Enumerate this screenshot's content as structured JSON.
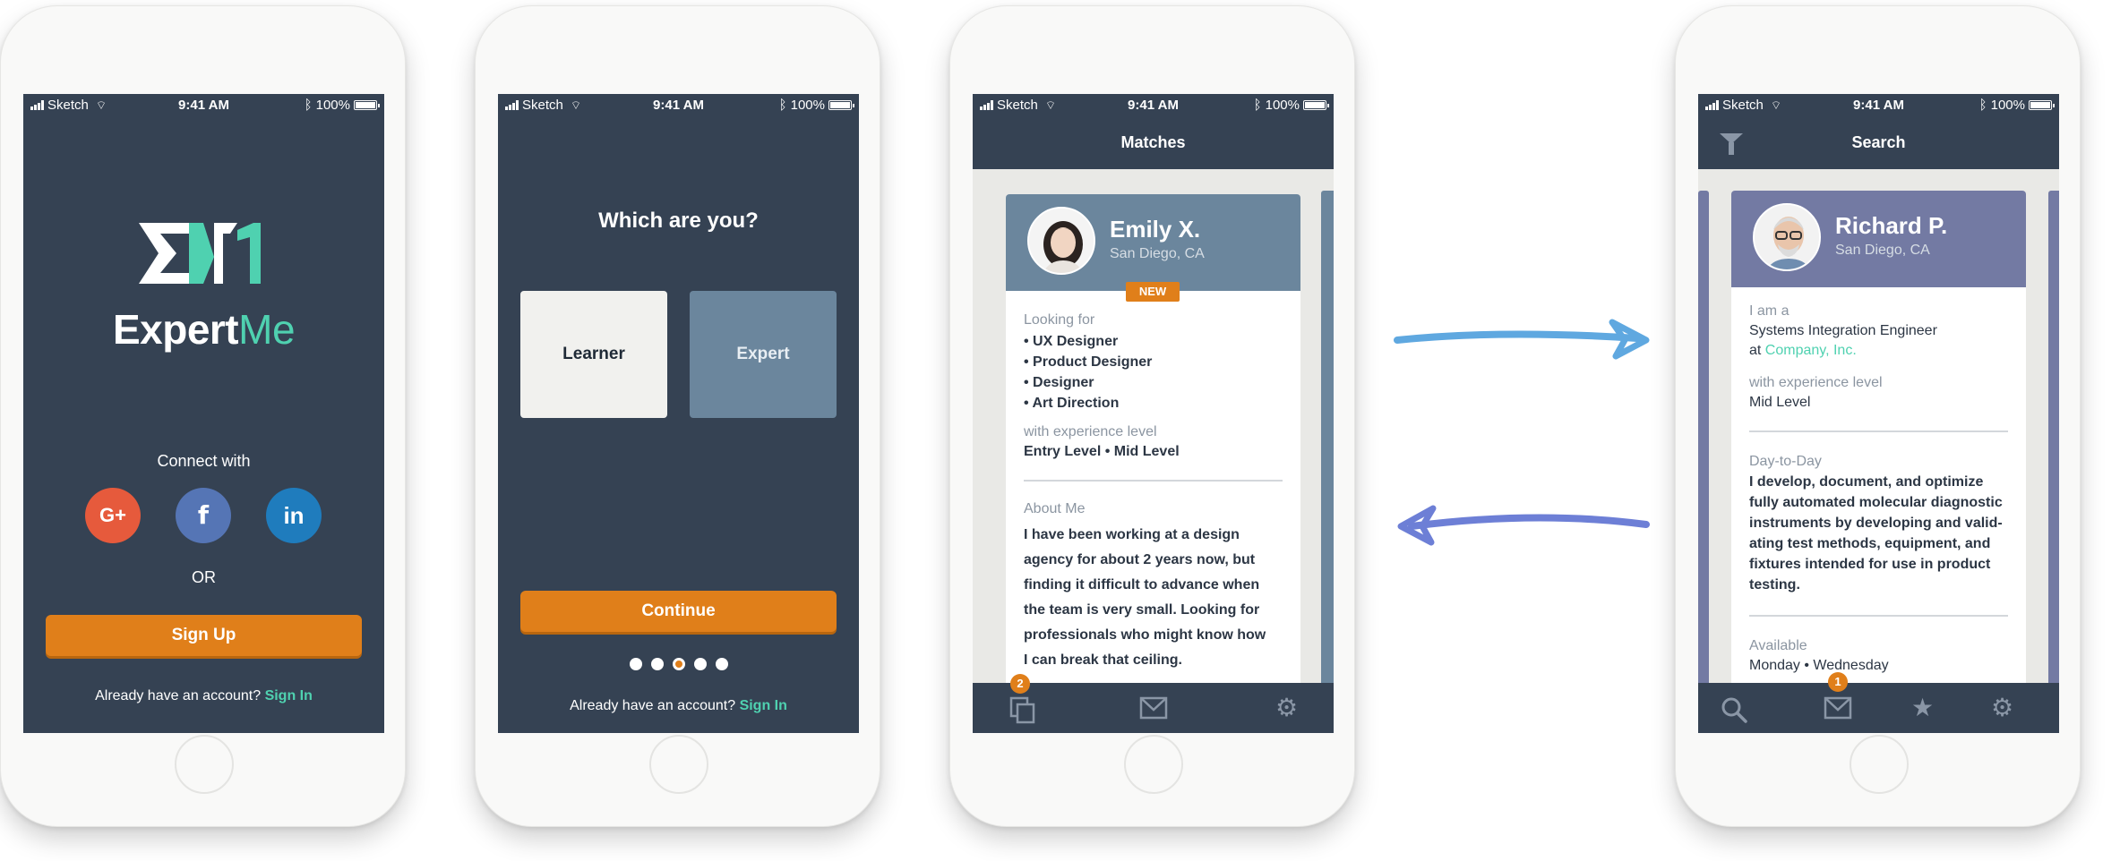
{
  "status": {
    "carrier": "Sketch",
    "time": "9:41 AM",
    "battery": "100%"
  },
  "screen1": {
    "brand_part1": "Expert",
    "brand_part2": "Me",
    "connect_label": "Connect with",
    "social_google": "G+",
    "social_facebook": "f",
    "social_linkedin": "in",
    "or_label": "OR",
    "signup_label": "Sign Up",
    "account_prompt": "Already have an account?",
    "signin_link": "Sign In"
  },
  "screen2": {
    "question": "Which are you?",
    "option_learner": "Learner",
    "option_expert": "Expert",
    "continue_label": "Continue",
    "account_prompt": "Already have an account?",
    "signin_link": "Sign In",
    "page_total": 5,
    "page_current": 3
  },
  "screen3": {
    "nav_title": "Matches",
    "name": "Emily X.",
    "location": "San Diego, CA",
    "badge_new": "NEW",
    "looking_for_label": "Looking for",
    "looking_for": [
      "• UX Designer",
      "• Product Designer",
      "• Designer",
      "• Art Direction"
    ],
    "experience_label": "with experience level",
    "experience_value": "Entry Level • Mid Level",
    "about_label": "About Me",
    "about_lines": [
      "I have been working at a design",
      "agency for about 2 years now, but",
      "finding it difficult to advance when",
      "the team is very small. Looking for",
      "professionals who might know how",
      "I can break that ceiling."
    ],
    "tab_badge": "2"
  },
  "screen4": {
    "nav_title": "Search",
    "name": "Richard P.",
    "location": "San Diego, CA",
    "iam_label": "I am a",
    "role": "Systems Integration Engineer",
    "at_word": "at",
    "company": "Company, Inc.",
    "experience_label": "with experience level",
    "experience_value": "Mid Level",
    "daytoday_label": "Day-to-Day",
    "daytoday_lines": [
      "I develop, document, and optimize",
      "fully automated molecular diagnostic",
      "instruments by developing and valid-",
      "ating test methods, equipment, and",
      "fixtures intended for use in product",
      "testing."
    ],
    "available_label": "Available",
    "available_value": "Monday • Wednesday",
    "tab_badge": "1"
  },
  "colors": {
    "navy": "#354253",
    "orange": "#e07f1a",
    "teal": "#4fd1b0",
    "google": "#e65a3c",
    "facebook": "#5575b5",
    "linkedin": "#1f7cbd",
    "card_head_emily": "#6b869d",
    "card_head_richard": "#737aa3",
    "arrow_right": "#5fa8e0",
    "arrow_left": "#6d7fd6"
  },
  "icons": [
    "signal-icon",
    "wifi-icon",
    "bluetooth-icon",
    "battery-icon",
    "cards-icon",
    "mail-icon",
    "gear-icon",
    "search-icon",
    "star-icon",
    "filter-icon",
    "arrow-right-icon",
    "arrow-left-icon"
  ]
}
